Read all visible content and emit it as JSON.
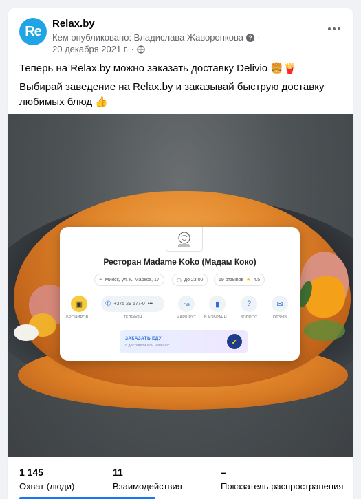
{
  "post": {
    "page_name": "Relax.by",
    "avatar_text": "Re",
    "published_by": "Кем опубликовано: Владислава Жаворонкова",
    "date": "20 декабря 2021 г.",
    "separator": "·",
    "text_line1": "Теперь на Relax.by можно заказать доставку Delivio 🍔🍟",
    "text_line2": "Выбирай заведение на Relax.by и заказывай быструю доставку любимых блюд 👍"
  },
  "app_card": {
    "restaurant_name": "Ресторан Madame Koko (Мадам Коко)",
    "address": "Минск, ул. К. Маркса, 17",
    "hours": "до 23:00",
    "reviews": "19 отзывов",
    "rating": "4.5",
    "phone": "+375 29 677-0",
    "phone_more": "•••",
    "actions": {
      "book": "БРОНИРОВ...",
      "phone": "ТЕЛЕФОН",
      "route": "МАРШРУТ",
      "favorites": "В ИЗБРАНН...",
      "question": "ВОПРОС",
      "review": "ОТЗЫВ"
    },
    "order_title": "ЗАКАЗАТЬ ЕДУ",
    "order_subtitle": "с доставкой или навынос"
  },
  "stats": {
    "reach_value": "1 145",
    "reach_label": "Охват (люди)",
    "engagement_value": "11",
    "engagement_label": "Взаимодействия",
    "distribution_value": "–",
    "distribution_label": "Показатель распространения"
  },
  "colors": {
    "accent": "#1877f2",
    "avatar": "#1fa4e6"
  }
}
